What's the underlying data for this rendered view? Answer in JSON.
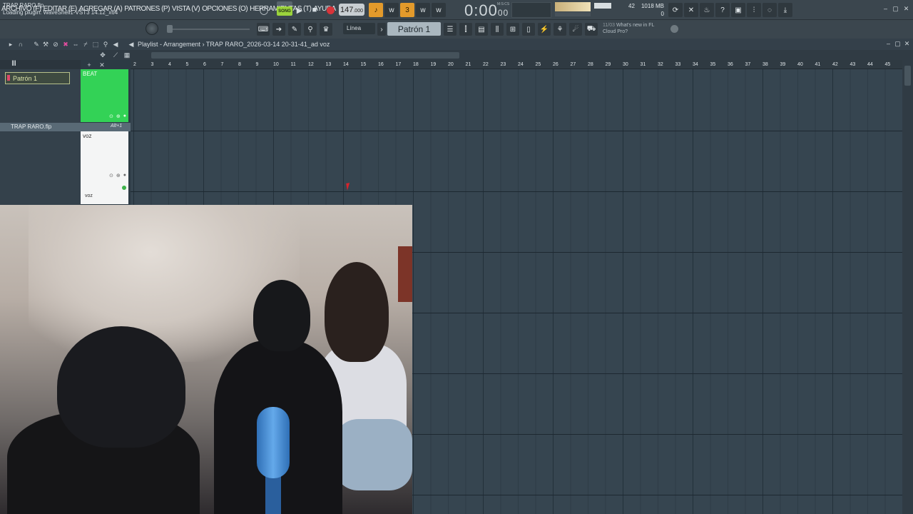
{
  "menu": [
    "ARCHIVO (F)",
    "EDITAR (E)",
    "AGREGAR (A)",
    "PATRONES (P)",
    "VISTA (V)",
    "OPCIONES (O)",
    "HERRAMIENTAS (T)",
    "AYUDA"
  ],
  "transport": {
    "song_label": "SONG",
    "tempo": "147",
    "tempo_decimal": ".000",
    "time_main": "0:00",
    "time_sub": "00",
    "time_label": "M:S:CS"
  },
  "monitor": {
    "cpu_value": "42",
    "memory": "1018 MB",
    "polyphony": "0"
  },
  "status": {
    "project_file": "TRAP RARO.flp",
    "hint_text": "Loading plugin: WaveShell1-VST3 14.12_x64"
  },
  "toolbar": {
    "snap_mode": "Línea",
    "pattern_selector": "Patrón 1"
  },
  "news": {
    "date": "11/03",
    "headline": "What's new in FL",
    "subline": "Cloud Pro?"
  },
  "playlist": {
    "title": "Playlist - Arrangement",
    "breadcrumb_sep": "›",
    "project_name": "TRAP RARO_2026-03-14 20-31-41_ad voz",
    "ruler_bars": [
      "2",
      "3",
      "4",
      "5",
      "6",
      "7",
      "8",
      "9",
      "10",
      "11",
      "12",
      "13",
      "14",
      "15",
      "16",
      "17",
      "18",
      "19",
      "20",
      "21",
      "22",
      "23",
      "24",
      "25",
      "26",
      "27",
      "28",
      "29",
      "30",
      "31",
      "32",
      "33",
      "34",
      "35",
      "36",
      "37",
      "38",
      "39",
      "40",
      "41",
      "42",
      "43",
      "44",
      "45"
    ]
  },
  "picker": {
    "pattern_item": "Patrón 1",
    "flp_file": "TRAP RARO.flp",
    "flp_shortcut": "Alt+1"
  },
  "tracks": [
    {
      "name": "BEAT",
      "color": "#33d256"
    },
    {
      "name": "voz",
      "color": "#f4f5f5"
    }
  ],
  "clip_label": "voz"
}
